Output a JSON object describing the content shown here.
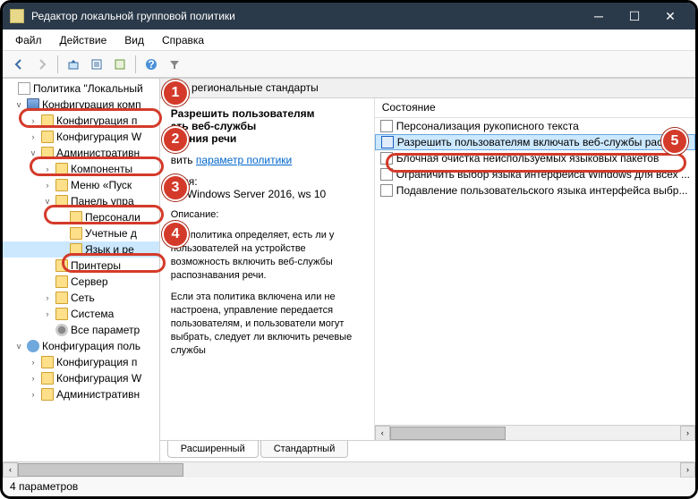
{
  "window": {
    "title": "Редактор локальной групповой политики"
  },
  "menu": {
    "file": "Файл",
    "action": "Действие",
    "view": "Вид",
    "help": "Справка"
  },
  "tree": {
    "root": "Политика \"Локальный",
    "comp": "Конфигурация комп",
    "comp_sw": "Конфигурация п",
    "comp_win": "Конфигурация W",
    "admin": "Административн",
    "components": "Компоненты",
    "startmenu": "Меню «Пуск",
    "cpanel": "Панель упра",
    "personal": "Персонали",
    "accounts": "Учетные д",
    "lang": "Язык и ре",
    "printers": "Принтеры",
    "server": "Сервер",
    "network": "Сеть",
    "system": "Система",
    "allparams": "Все параметр",
    "usercfg": "Конфигурация поль",
    "user_sw": "Конфигурация п",
    "user_win": "Конфигурация W",
    "user_admin": "Административн"
  },
  "rightHeader": "ык и региональные стандарты",
  "desc": {
    "heading1": "Разрешить пользователям",
    "heading2": "ать веб-службы",
    "heading3": "авания речи",
    "editLink": "параметр политики",
    "editPrefix": "вить ",
    "reqLabel": "ания:",
    "reqText": "же Windows Server 2016, ws 10",
    "descLabel": "Описание:",
    "p1": "Эта политика определяет, есть ли у пользователей на устройстве возможность включить веб-службы распознавания речи.",
    "p2": "Если эта политика включена или не настроена, управление передается пользователям, и пользователи могут выбрать, следует ли включить речевые службы"
  },
  "listHeader": {
    "state": "Состояние"
  },
  "list": {
    "r0": "Персонализация рукописного текста",
    "r1": "Разрешить пользователям включать веб-службы распоз...",
    "r2": "Блочная очистка неиспользуемых языковых пакетов",
    "r3": "Ограничить выбор языка интерфейса Windows для всех ...",
    "r4": "Подавление пользовательского языка интерфейса выбр..."
  },
  "tabs": {
    "extended": "Расширенный",
    "standard": "Стандартный"
  },
  "status": "4 параметров"
}
